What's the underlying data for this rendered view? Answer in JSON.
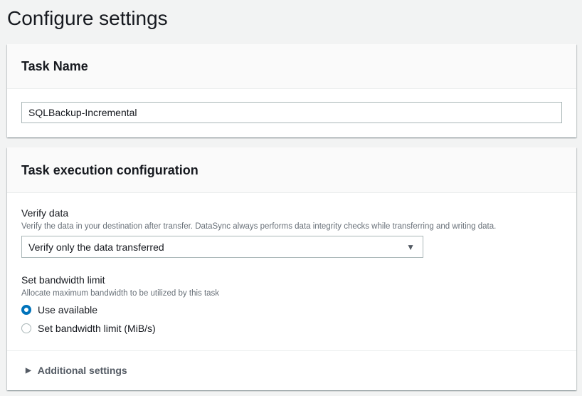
{
  "page": {
    "title": "Configure settings"
  },
  "task_name": {
    "heading": "Task Name",
    "value": "SQLBackup-Incremental"
  },
  "execution": {
    "heading": "Task execution configuration",
    "verify": {
      "label": "Verify data",
      "description": "Verify the data in your destination after transfer. DataSync always performs data integrity checks while transferring and writing data.",
      "selected": "Verify only the data transferred"
    },
    "bandwidth": {
      "label": "Set bandwidth limit",
      "description": "Allocate maximum bandwidth to be utilized by this task",
      "options": [
        {
          "label": "Use available",
          "checked": true
        },
        {
          "label": "Set bandwidth limit (MiB/s)",
          "checked": false
        }
      ]
    },
    "additional": "Additional settings"
  },
  "colors": {
    "accent": "#0073bb",
    "background": "#f2f3f3"
  }
}
